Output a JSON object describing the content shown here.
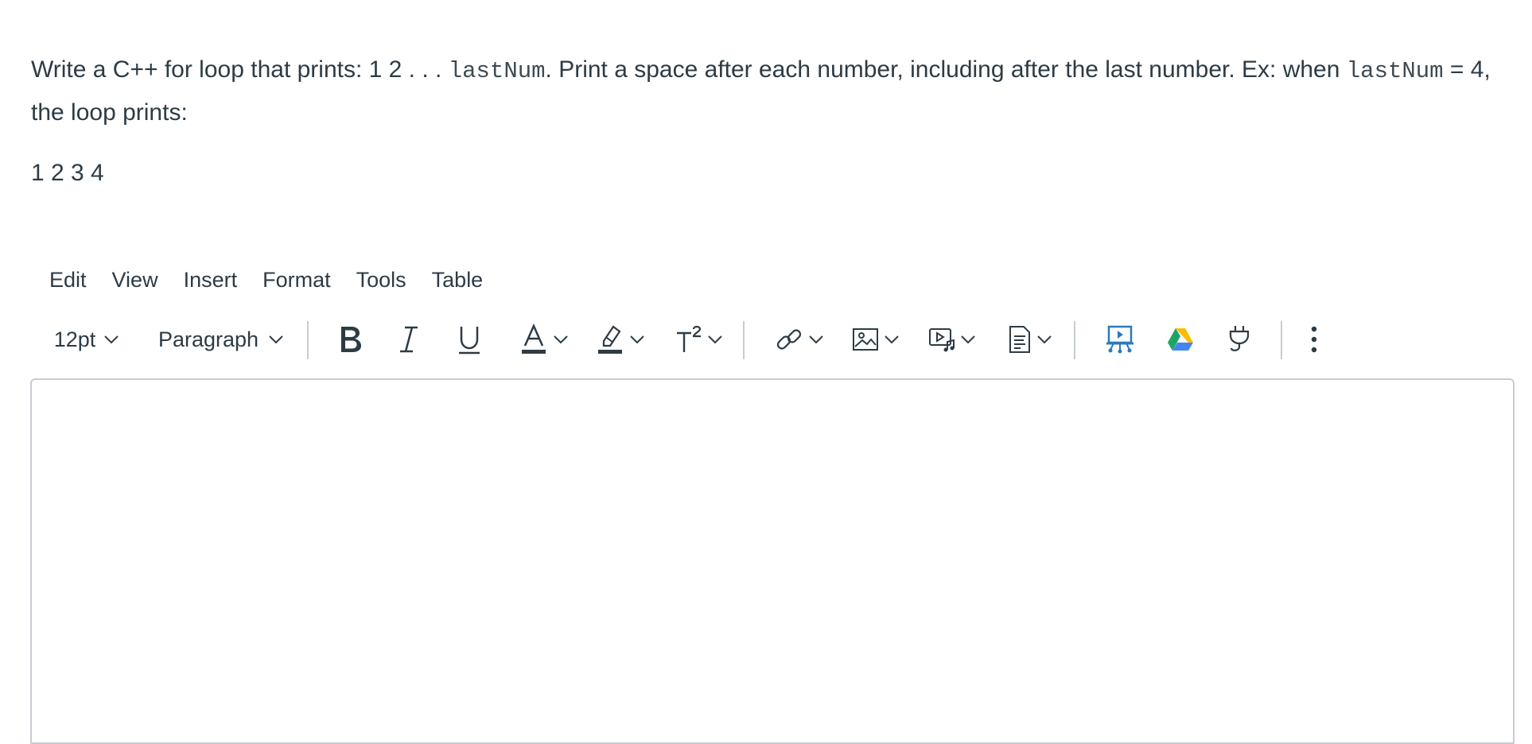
{
  "question": {
    "part1": "Write a C++ for loop that prints: 1 2 . . . ",
    "code1": "lastNum",
    "part2": ". Print a space after each number, including after the last number. Ex: when ",
    "code2": "lastNum",
    "part3": " = 4, the loop prints:"
  },
  "example_output": "1 2 3 4",
  "menubar": {
    "edit": "Edit",
    "view": "View",
    "insert": "Insert",
    "format": "Format",
    "tools": "Tools",
    "table": "Table"
  },
  "toolbar": {
    "font_size": "12pt",
    "block_format": "Paragraph",
    "icons": {
      "bold": "bold-icon",
      "italic": "italic-icon",
      "underline": "underline-icon",
      "text_color": "text-color-icon",
      "highlight": "highlight-icon",
      "superscript": "superscript-icon",
      "link": "link-icon",
      "image": "image-icon",
      "media": "media-icon",
      "document": "document-icon",
      "lti_tool": "presentation-tool-icon",
      "google_drive": "google-drive-icon",
      "plugin": "plug-icon",
      "more": "more-vertical-icon"
    }
  },
  "colors": {
    "text": "#2d3b45",
    "border": "#c7cdd1",
    "accent_blue": "#2b7abc"
  }
}
